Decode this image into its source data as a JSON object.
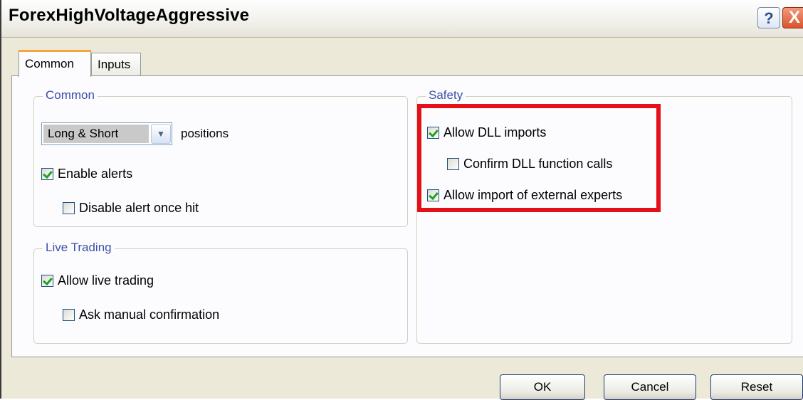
{
  "window": {
    "title": "ForexHighVoltageAggressive"
  },
  "titlebar": {
    "help_label": "?",
    "close_label": "X"
  },
  "tabs": [
    {
      "label": "Common"
    },
    {
      "label": "Inputs"
    }
  ],
  "common_group": {
    "legend": "Common",
    "positions_select": {
      "value": "Long & Short"
    },
    "positions_label": "positions",
    "enable_alerts": {
      "label": "Enable alerts",
      "checked": true
    },
    "disable_alert_once_hit": {
      "label": "Disable alert once hit",
      "checked": false
    }
  },
  "live_trading_group": {
    "legend": "Live Trading",
    "allow_live_trading": {
      "label": "Allow live trading",
      "checked": true
    },
    "ask_manual_confirmation": {
      "label": "Ask manual confirmation",
      "checked": false
    }
  },
  "safety_group": {
    "legend": "Safety",
    "allow_dll_imports": {
      "label": "Allow DLL imports",
      "checked": true
    },
    "confirm_dll_function_calls": {
      "label": "Confirm DLL function calls",
      "checked": false
    },
    "allow_import_external_experts": {
      "label": "Allow import of external experts",
      "checked": true
    }
  },
  "buttons": {
    "ok": "OK",
    "cancel": "Cancel",
    "reset": "Reset"
  },
  "colors": {
    "highlight": "#e3101a",
    "tab_accent": "#f4a83a",
    "check": "#21a121"
  }
}
